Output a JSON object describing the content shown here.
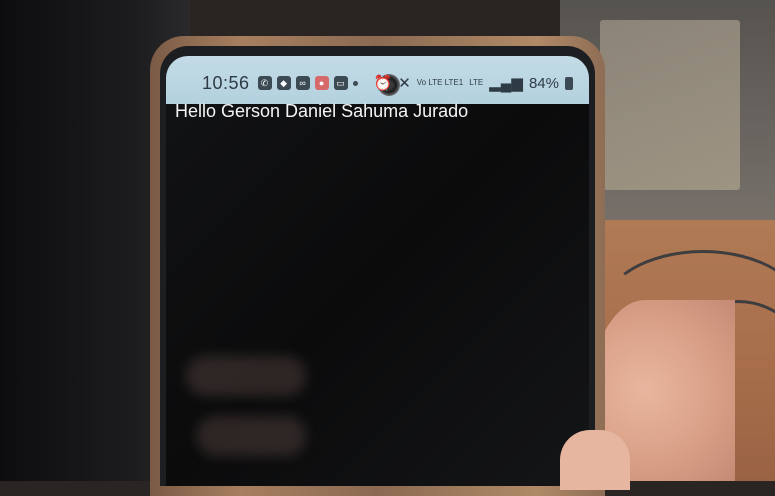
{
  "status_bar": {
    "time": "10:56",
    "notification_icons": [
      "whatsapp-icon",
      "game-icon",
      "voicemail-icon",
      "app-icon",
      "twitch-icon"
    ],
    "network_small": "Vo LTE LTE1",
    "network_label": "LTE",
    "battery": "84%"
  },
  "app": {
    "greeting": "Hello Gerson Daniel Sahuma Jurado"
  }
}
